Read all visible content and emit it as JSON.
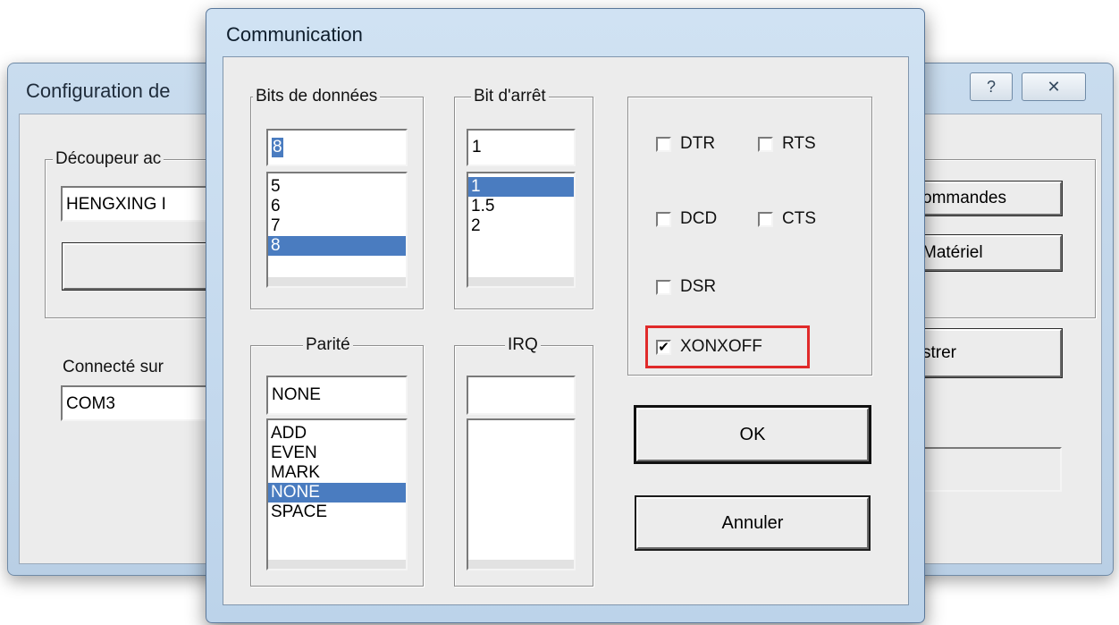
{
  "background_window": {
    "title": "Configuration de",
    "help_symbol": "?",
    "close_symbol": "✕",
    "group_label": "Découpeur ac",
    "cutter_value": "HENGXING I",
    "connected_label": "Connecté sur",
    "port_value": "COM3",
    "btn_commandes": "ommandes",
    "btn_materiel": "Matériel",
    "btn_register": "strer"
  },
  "dialog": {
    "title": "Communication",
    "data_bits": {
      "label": "Bits de données",
      "value": "8",
      "options": [
        "5",
        "6",
        "7",
        "8"
      ],
      "selected": "8"
    },
    "stop_bits": {
      "label": "Bit d'arrêt",
      "value": "1",
      "options": [
        "1",
        "1.5",
        "2"
      ],
      "selected": "1"
    },
    "parity": {
      "label": "Parité",
      "value": "NONE",
      "options": [
        "ADD",
        "EVEN",
        "MARK",
        "NONE",
        "SPACE"
      ],
      "selected": "NONE"
    },
    "irq": {
      "label": "IRQ",
      "value": "",
      "options": []
    },
    "checkboxes": {
      "dtr": {
        "label": "DTR",
        "checked": false
      },
      "rts": {
        "label": "RTS",
        "checked": false
      },
      "dcd": {
        "label": "DCD",
        "checked": false
      },
      "cts": {
        "label": "CTS",
        "checked": false
      },
      "dsr": {
        "label": "DSR",
        "checked": false
      },
      "xonxoff": {
        "label": "XONXOFF",
        "checked": true,
        "check_glyph": "✔"
      }
    },
    "ok_label": "OK",
    "cancel_label": "Annuler",
    "highlight_color": "#e02a2a",
    "selection_color": "#4a7cc0"
  }
}
